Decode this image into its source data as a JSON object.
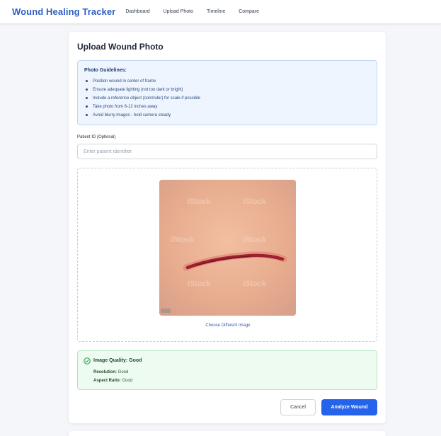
{
  "nav": {
    "brand": "Wound Healing Tracker",
    "links": [
      "Dashboard",
      "Upload Photo",
      "Timeline",
      "Compare"
    ]
  },
  "upload": {
    "title": "Upload Wound Photo",
    "guidelines": {
      "title": "Photo Guidelines:",
      "items": [
        "Position wound in center of frame",
        "Ensure adequate lighting (not too dark or bright)",
        "Include a reference object (coin/ruler) for scale if possible",
        "Take photo from 6-12 inches away",
        "Avoid blurry images - hold camera steady"
      ]
    },
    "patient_id": {
      "label": "Patient ID (Optional)",
      "placeholder": "Enter patient identifier",
      "value": ""
    },
    "preview": {
      "watermark": "iStock"
    },
    "choose_label": "Choose Different Image",
    "quality": {
      "title": "Image Quality: Good",
      "resolution_label": "Resolution:",
      "resolution_value": "Good",
      "aspect_label": "Aspect Ratio:",
      "aspect_value": "Good"
    },
    "cancel_label": "Cancel",
    "analyze_label": "Analyze Wound"
  },
  "colors": {
    "brand": "#2f5fc4",
    "primary_button": "#2563eb",
    "guidelines_bg": "#eef5fe",
    "quality_bg": "#eefbf0",
    "quality_icon": "#22a04b"
  }
}
